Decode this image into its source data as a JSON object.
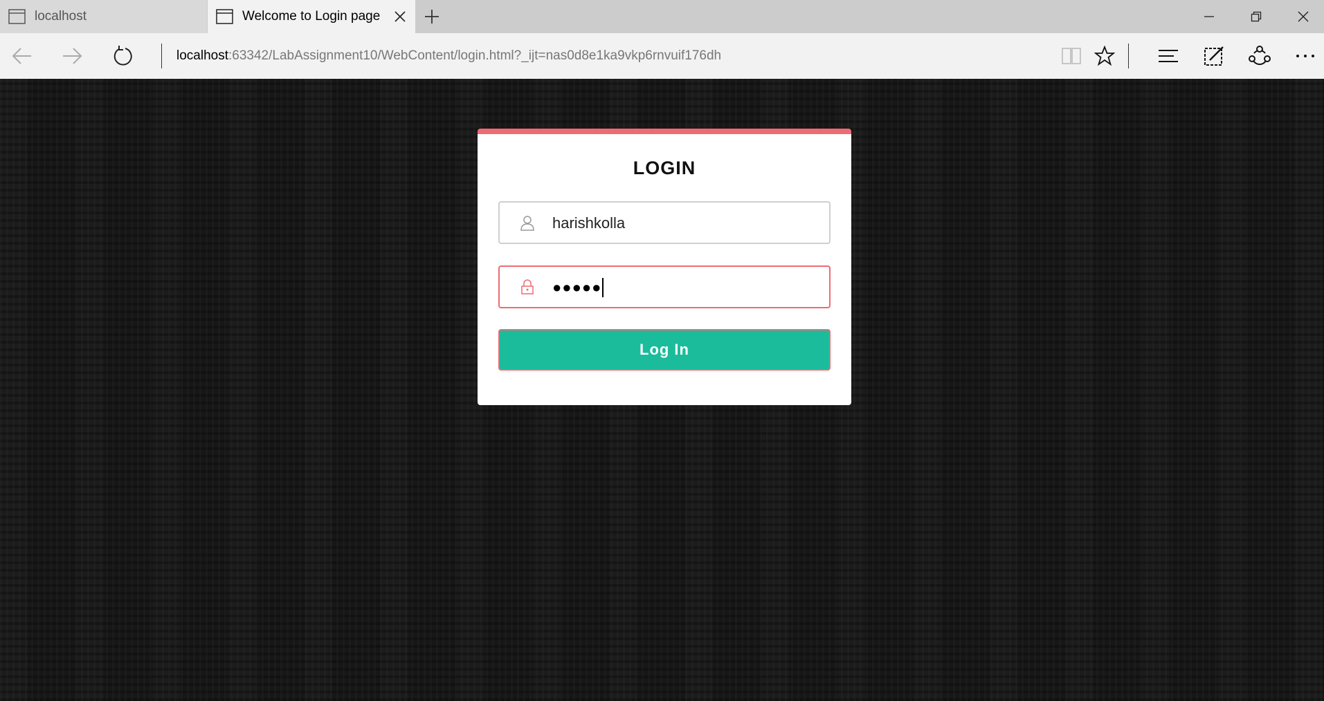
{
  "browser": {
    "tabs": [
      {
        "title": "localhost",
        "active": false
      },
      {
        "title": "Welcome to Login page",
        "active": true
      }
    ],
    "address": {
      "host": "localhost",
      "path": ":63342/LabAssignment10/WebContent/login.html?_ijt=nas0d8e1ka9vkp6rnvuif176dh"
    },
    "icons": {
      "back": "back-arrow-icon",
      "forward": "forward-arrow-icon",
      "refresh": "refresh-icon",
      "reading_view": "reading-view-icon",
      "favorite": "star-icon",
      "hub": "hub-icon",
      "web_note": "web-note-icon",
      "share": "share-icon",
      "more": "more-icon"
    }
  },
  "login": {
    "title": "LOGIN",
    "username_value": "harishkolla",
    "password_masked": "●●●●●",
    "button_label": "Log In"
  },
  "colors": {
    "accent_red": "#ee6b73",
    "button_teal": "#1abc9c",
    "background": "#171717"
  }
}
